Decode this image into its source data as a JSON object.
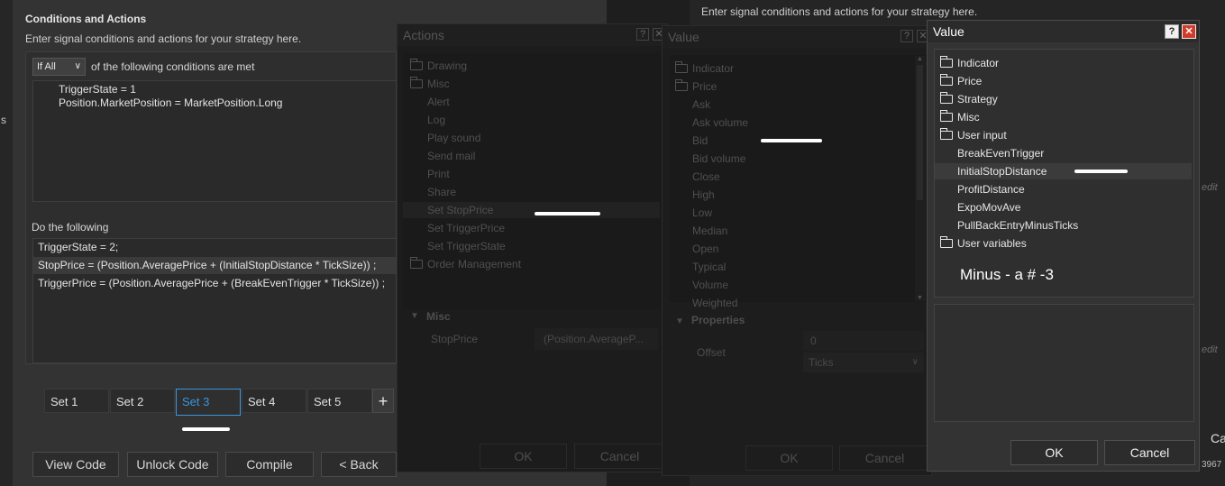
{
  "main": {
    "heading": "Conditions and Actions",
    "subheading": "Enter signal conditions and actions for your strategy here.",
    "if_select": "If All",
    "if_suffix": "of the following conditions are met",
    "conditions": [
      "TriggerState = 1",
      "Position.MarketPosition = MarketPosition.Long"
    ],
    "do_label": "Do the following",
    "actions": [
      "TriggerState = 2;",
      "StopPrice = (Position.AveragePrice + (InitialStopDistance * TickSize)) ;",
      "TriggerPrice = (Position.AveragePrice + (BreakEvenTrigger * TickSize)) ;"
    ],
    "sets": [
      "Set 1",
      "Set 2",
      "Set 3",
      "Set 4",
      "Set 5"
    ],
    "add_set": "+",
    "active_set": "Set 3",
    "buttons": {
      "view_code": "View Code",
      "unlock_code": "Unlock Code",
      "compile": "Compile",
      "back": "< Back"
    },
    "left_edge_text": "s"
  },
  "background": {
    "subheading": "Enter signal conditions and actions for your strategy here.",
    "edit_1": "edit",
    "edit_2": "edit",
    "cancel_partial": "Ca",
    "number_partial": "3967"
  },
  "actions_dialog": {
    "title": "Actions",
    "help": "?",
    "close": "✕",
    "tree": [
      {
        "label": "Drawing",
        "folder": true
      },
      {
        "label": "Misc",
        "folder": true,
        "open": true
      },
      {
        "label": "Alert"
      },
      {
        "label": "Log"
      },
      {
        "label": "Play sound"
      },
      {
        "label": "Send mail"
      },
      {
        "label": "Print"
      },
      {
        "label": "Share"
      },
      {
        "label": "Set StopPrice",
        "selected": true
      },
      {
        "label": "Set TriggerPrice"
      },
      {
        "label": "Set TriggerState"
      },
      {
        "label": "Order Management",
        "folder": true
      }
    ],
    "section": "Misc",
    "property_name": "StopPrice",
    "property_value": "(Position.AverageP...",
    "ok": "OK",
    "cancel": "Cancel"
  },
  "value_dialog_mid": {
    "title": "Value",
    "help": "?",
    "close": "✕",
    "tree": [
      {
        "label": "Indicator",
        "folder": true
      },
      {
        "label": "Price",
        "folder": true,
        "open": true
      },
      {
        "label": "Ask"
      },
      {
        "label": "Ask volume"
      },
      {
        "label": "Bid"
      },
      {
        "label": "Bid volume"
      },
      {
        "label": "Close"
      },
      {
        "label": "High"
      },
      {
        "label": "Low"
      },
      {
        "label": "Median"
      },
      {
        "label": "Open"
      },
      {
        "label": "Typical"
      },
      {
        "label": "Volume"
      },
      {
        "label": "Weighted"
      }
    ],
    "section": "Properties",
    "offset_label": "Offset",
    "offset_value": "0",
    "offset_unit": "Ticks",
    "ok": "OK",
    "cancel": "Cancel"
  },
  "value_dialog_front": {
    "title": "Value",
    "help": "?",
    "close": "✕",
    "tree": [
      {
        "label": "Indicator",
        "folder": true
      },
      {
        "label": "Price",
        "folder": true
      },
      {
        "label": "Strategy",
        "folder": true
      },
      {
        "label": "Misc",
        "folder": true
      },
      {
        "label": "User input",
        "folder": true,
        "open": true
      },
      {
        "label": "BreakEvenTrigger"
      },
      {
        "label": "InitialStopDistance",
        "selected": true
      },
      {
        "label": "ProfitDistance"
      },
      {
        "label": "ExpoMovAve"
      },
      {
        "label": "PullBackEntryMinusTicks"
      },
      {
        "label": "User variables",
        "folder": true
      }
    ],
    "annotation": "Minus - a #  -3",
    "ok": "OK",
    "cancel": "Cancel"
  }
}
